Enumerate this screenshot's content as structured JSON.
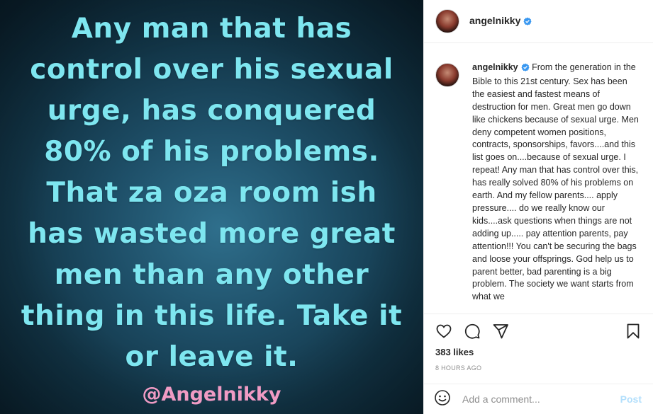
{
  "media": {
    "quote_lines": [
      "Any man that has",
      "control over his sexual",
      "urge, has conquered",
      "80% of his problems.",
      "That za oza room ish",
      "has wasted more great",
      "men than any other",
      "thing in this life. Take it",
      "or leave it."
    ],
    "watermark": "@Angelnikky"
  },
  "header": {
    "username": "angelnikky"
  },
  "caption": {
    "username": "angelnikky",
    "text": "From the generation in the Bible to this 21st century. Sex has been the easiest and fastest means of destruction for men. Great men go down like chickens because of sexual urge. Men deny competent women positions, contracts, sponsorships, favors....and this list goes on....because of sexual urge. I repeat! Any man that has control over this, has really solved 80% of his problems on earth. And my fellow parents.... apply pressure.... do we really know our kids....ask questions when things are not adding up..... pay attention parents, pay attention!!! You can't be securing the bags and loose your offsprings. God help us to parent better, bad parenting is a big problem. The society we want starts from what we"
  },
  "actions": {
    "likes": "383 likes",
    "timestamp": "8 HOURS AGO"
  },
  "comment": {
    "placeholder": "Add a comment...",
    "post_label": "Post"
  },
  "colors": {
    "quote_text": "#7ee6f0",
    "watermark": "#f09bc4",
    "verified_badge": "#3897f0",
    "post_button": "#b2dffc"
  },
  "icons": [
    "verified-badge-icon",
    "heart-icon",
    "comment-icon",
    "share-icon",
    "bookmark-icon",
    "emoji-icon"
  ]
}
